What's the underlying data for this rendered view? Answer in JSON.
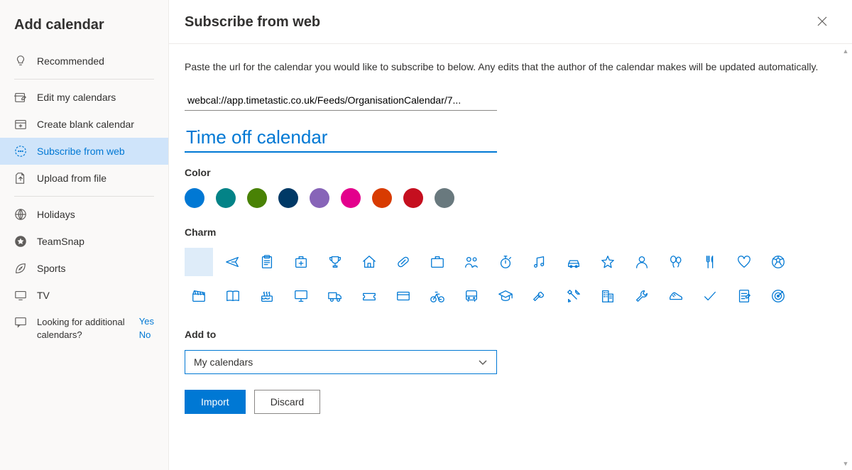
{
  "sidebar": {
    "title": "Add calendar",
    "items": [
      {
        "label": "Recommended",
        "icon": "lightbulb"
      },
      {
        "label": "Edit my calendars",
        "icon": "edit-cal"
      },
      {
        "label": "Create blank calendar",
        "icon": "add-cal"
      },
      {
        "label": "Subscribe from web",
        "icon": "web-sub",
        "selected": true
      },
      {
        "label": "Upload from file",
        "icon": "upload"
      },
      {
        "label": "Holidays",
        "icon": "globe"
      },
      {
        "label": "TeamSnap",
        "icon": "teamsnap"
      },
      {
        "label": "Sports",
        "icon": "football"
      },
      {
        "label": "TV",
        "icon": "tv"
      }
    ],
    "feedback": {
      "q": "Looking for additional calendars?",
      "yes": "Yes",
      "no": "No"
    }
  },
  "header": {
    "title": "Subscribe from web"
  },
  "instructions": "Paste the url for the calendar you would like to subscribe to below. Any edits that the author of the calendar makes will be updated automatically.",
  "url_value": "webcal://app.timetastic.co.uk/Feeds/OrganisationCalendar/7...",
  "name_value": "Time off calendar",
  "labels": {
    "color": "Color",
    "charm": "Charm",
    "addto": "Add to"
  },
  "colors": [
    "#0078d4",
    "#038387",
    "#498205",
    "#003966",
    "#8764b8",
    "#e3008c",
    "#d83b01",
    "#c50f1f",
    "#69797e"
  ],
  "charms": [
    "none",
    "plane",
    "clipboard",
    "medkit",
    "trophy",
    "house",
    "pill",
    "briefcase",
    "people",
    "stopwatch",
    "music",
    "car",
    "star",
    "person",
    "balloons",
    "fork",
    "heart",
    "soccer",
    "clapper",
    "book",
    "cake",
    "monitor",
    "truck",
    "ticket",
    "credit",
    "bike",
    "bus",
    "grad",
    "repair",
    "tools",
    "building",
    "wrench",
    "shoe",
    "check",
    "notes",
    "target"
  ],
  "addto_value": "My calendars",
  "buttons": {
    "import": "Import",
    "discard": "Discard"
  }
}
